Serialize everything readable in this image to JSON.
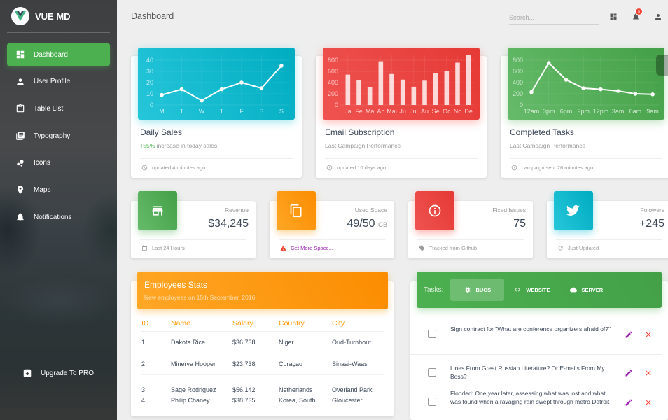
{
  "brand": {
    "name": "VUE MD",
    "logo_icon": "vue-logo-icon"
  },
  "sidebar": {
    "items": [
      {
        "label": "Dashboard",
        "icon": "dashboard-icon",
        "active": true
      },
      {
        "label": "User Profile",
        "icon": "person-icon",
        "active": false
      },
      {
        "label": "Table List",
        "icon": "clipboard-icon",
        "active": false
      },
      {
        "label": "Typography",
        "icon": "library-books-icon",
        "active": false
      },
      {
        "label": "Icons",
        "icon": "bubble-chart-icon",
        "active": false
      },
      {
        "label": "Maps",
        "icon": "location-pin-icon",
        "active": false
      },
      {
        "label": "Notifications",
        "icon": "bell-icon",
        "active": false
      }
    ],
    "upgrade": {
      "label": "Upgrade To PRO",
      "icon": "unarchive-icon"
    }
  },
  "header": {
    "title": "Dashboard",
    "search_placeholder": "Search...",
    "notification_count": "5",
    "icons": [
      "dashboard-icon",
      "bell-icon",
      "person-icon"
    ]
  },
  "colors": {
    "green": "#4caf50",
    "red": "#f44336",
    "orange": "#ff9800",
    "cyan": "#00bcd4",
    "purple": "#9c27b0"
  },
  "chart_data": [
    {
      "type": "line",
      "title": "Daily Sales",
      "categories": [
        "M",
        "T",
        "W",
        "T",
        "F",
        "S",
        "S"
      ],
      "values": [
        9,
        14,
        4,
        14,
        20,
        15,
        35
      ],
      "yticks": [
        0,
        10,
        20,
        30,
        40
      ],
      "ylim": [
        0,
        45
      ],
      "grid": true,
      "color": "#00bcd4"
    },
    {
      "type": "bar",
      "title": "Email Subscription",
      "categories": [
        "Ja",
        "Fe",
        "Ma",
        "Ap",
        "Mai",
        "Ju",
        "Jul",
        "Au",
        "Se",
        "Oc",
        "No",
        "De"
      ],
      "values": [
        542,
        443,
        320,
        780,
        553,
        453,
        326,
        434,
        568,
        610,
        756,
        895
      ],
      "yticks": [
        0,
        200,
        400,
        600,
        800
      ],
      "ylim": [
        0,
        900
      ],
      "grid": true,
      "color": "#f44336"
    },
    {
      "type": "line",
      "title": "Completed Tasks",
      "categories": [
        "12am",
        "3pm",
        "6pm",
        "9pm",
        "12pm",
        "3am",
        "6am",
        "9am"
      ],
      "values": [
        230,
        750,
        450,
        300,
        280,
        250,
        200,
        190
      ],
      "yticks": [
        0,
        200,
        400,
        600,
        800
      ],
      "ylim": [
        0,
        900
      ],
      "grid": true,
      "color": "#4caf50"
    }
  ],
  "chart_cards": [
    {
      "title": "Daily Sales",
      "sub_highlight": "55%",
      "sub_text": " increase in today sales.",
      "footer": "updated 4 minutes ago"
    },
    {
      "title": "Email Subscription",
      "sub_text": "Last Campaign Performance",
      "footer": "updated 10 days ago"
    },
    {
      "title": "Completed Tasks",
      "sub_text": "Last Campaign Performance",
      "footer": "campaign sent 26 minutes ago"
    }
  ],
  "stats": [
    {
      "label": "Revenue",
      "value": "$34,245",
      "unit": "",
      "footer": "Last 24 Hours",
      "icon": "store-icon",
      "footer_icon": "calendar-icon"
    },
    {
      "label": "Used Space",
      "value": "49/50",
      "unit": "GB",
      "footer": "Get More Space...",
      "icon": "content-copy-icon",
      "footer_icon": "warning-icon"
    },
    {
      "label": "Fixed Issues",
      "value": "75",
      "unit": "",
      "footer": "Tracked from Github",
      "icon": "info-outline-icon",
      "footer_icon": "tag-icon"
    },
    {
      "label": "Folowers",
      "value": "+245",
      "unit": "",
      "footer": "Just Updated",
      "icon": "twitter-icon",
      "footer_icon": "refresh-icon"
    }
  ],
  "employees": {
    "title": "Employees Stats",
    "subtitle": "New employees on 15th September, 2016",
    "columns": [
      "ID",
      "Name",
      "Salary",
      "Country",
      "City"
    ],
    "rows": [
      [
        "1",
        "Dakota Rice",
        "$36,738",
        "Niger",
        "Oud-Turnhout"
      ],
      [
        "2",
        "Minerva Hooper",
        "$23,738",
        "Curaçao",
        "Sinaai-Waas"
      ],
      [
        "3",
        "Sage Rodriguez",
        "$56,142",
        "Netherlands",
        "Overland Park"
      ],
      [
        "4",
        "Philip Chaney",
        "$38,735",
        "Korea, South",
        "Gloucester"
      ]
    ]
  },
  "tasks": {
    "label": "Tasks:",
    "tabs": [
      {
        "label": "BUGS",
        "icon": "bug-icon",
        "active": true
      },
      {
        "label": "WEBSITE",
        "icon": "code-icon",
        "active": false
      },
      {
        "label": "SERVER",
        "icon": "cloud-icon",
        "active": false
      }
    ],
    "items": [
      {
        "text": "Sign contract for \"What are conference organizers afraid of?\"",
        "checked": false
      },
      {
        "text": "Lines From Great Russian Literature? Or E-mails From My Boss?",
        "checked": false
      },
      {
        "text": "Flooded: One year later, assessing what was lost and what was found when a ravaging rain swept through metro Detroit",
        "checked": false
      }
    ]
  }
}
